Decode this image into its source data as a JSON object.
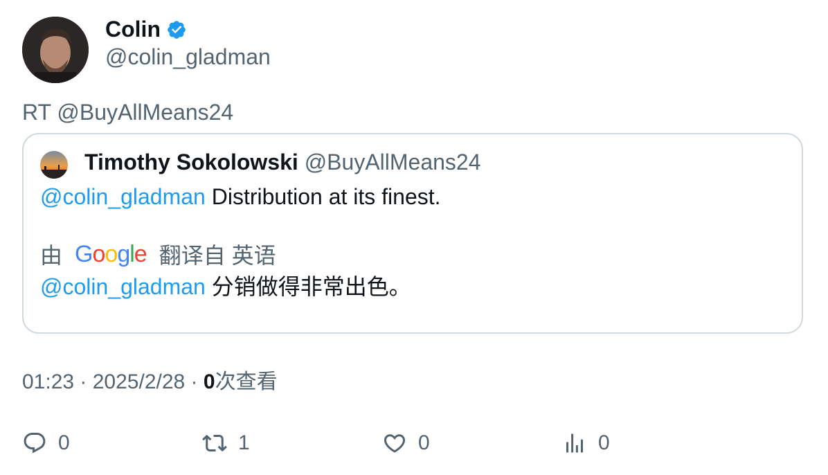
{
  "author": {
    "display_name": "Colin",
    "handle": "@colin_gladman",
    "verified": true
  },
  "retweet_line": "RT @BuyAllMeans24",
  "quoted": {
    "display_name": "Timothy Sokolowski",
    "handle": "@BuyAllMeans24",
    "mention": "@colin_gladman",
    "text": " Distribution at its finest.",
    "translation": {
      "prefix": "由",
      "provider": "Google",
      "suffix": "翻译自 英语",
      "mention": "@colin_gladman",
      "text": " 分销做得非常出色。"
    }
  },
  "meta": {
    "time": "01:23",
    "separator": " · ",
    "date": "2025/2/28",
    "views_count": "0",
    "views_label": "次查看"
  },
  "actions": {
    "reply_count": "0",
    "retweet_count": "1",
    "like_count": "0",
    "views_count": "0"
  },
  "colors": {
    "accent": "#1d9bf0",
    "text_primary": "#0f1419",
    "text_secondary": "#536471",
    "border": "#cfd9de"
  }
}
